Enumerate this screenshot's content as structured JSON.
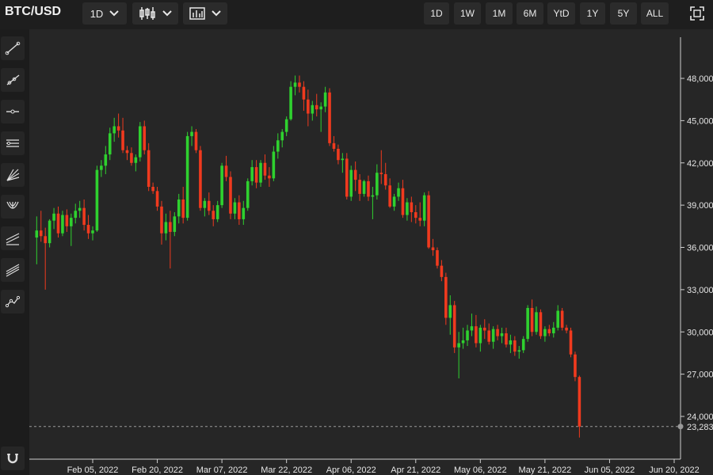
{
  "header": {
    "symbol": "BTC/USD",
    "interval_label": "1D",
    "chart_type_icon": "candlestick-icon",
    "indicators_icon": "indicators-icon",
    "ranges": [
      "1D",
      "1W",
      "1M",
      "6M",
      "YtD",
      "1Y",
      "5Y",
      "ALL"
    ],
    "fullscreen_icon": "fullscreen-icon"
  },
  "toolbar": {
    "tools": [
      "trend-line-icon",
      "ray-icon",
      "horizontal-line-icon",
      "parallel-channel-icon",
      "fib-fan-icon",
      "pitchfork-icon",
      "regression-channel-icon",
      "gann-fan-icon",
      "path-icon"
    ],
    "magnet_icon": "magnet-icon"
  },
  "colors": {
    "up": "#2fd12f",
    "down": "#f03a1e",
    "background": "#262626",
    "grid": "#3a3a3a"
  },
  "chart_data": {
    "type": "candlestick",
    "ylim": [
      21000,
      50500
    ],
    "y_ticks": [
      "48,000",
      "45,000",
      "42,000",
      "39,000",
      "36,000",
      "33,000",
      "30,000",
      "27,000",
      "24,000"
    ],
    "y_tick_values": [
      48000,
      45000,
      42000,
      39000,
      36000,
      33000,
      30000,
      27000,
      24000
    ],
    "x_ticks": [
      "Feb 05, 2022",
      "Feb 20, 2022",
      "Mar 07, 2022",
      "Mar 22, 2022",
      "Apr 06, 2022",
      "Apr 21, 2022",
      "May 06, 2022",
      "May 21, 2022",
      "Jun 05, 2022",
      "Jun 20, 2022"
    ],
    "x_tick_days": [
      35,
      50,
      65,
      80,
      95,
      110,
      125,
      140,
      155,
      170
    ],
    "first_day": 22,
    "last_price": 23283,
    "last_price_label": "23,283",
    "candles": [
      [
        36700,
        38200,
        34800,
        37200
      ],
      [
        37200,
        38600,
        36400,
        36800
      ],
      [
        36800,
        37400,
        33000,
        36300
      ],
      [
        36300,
        38000,
        36000,
        37900
      ],
      [
        37900,
        38800,
        37300,
        38400
      ],
      [
        38400,
        38900,
        36700,
        37000
      ],
      [
        37000,
        38600,
        36800,
        38300
      ],
      [
        38300,
        38700,
        37100,
        37500
      ],
      [
        37500,
        38400,
        36100,
        38100
      ],
      [
        38100,
        39100,
        37700,
        38600
      ],
      [
        38600,
        39300,
        38100,
        38800
      ],
      [
        38800,
        39400,
        37200,
        37600
      ],
      [
        37600,
        38300,
        36600,
        37000
      ],
      [
        37000,
        37500,
        36500,
        37200
      ],
      [
        37200,
        41800,
        37100,
        41500
      ],
      [
        41500,
        42200,
        41000,
        41800
      ],
      [
        41800,
        43200,
        41200,
        42600
      ],
      [
        42600,
        44500,
        42200,
        44100
      ],
      [
        44100,
        45200,
        43500,
        44600
      ],
      [
        44600,
        45500,
        43800,
        44300
      ],
      [
        44300,
        45200,
        42700,
        42900
      ],
      [
        42900,
        43200,
        42200,
        42700
      ],
      [
        42700,
        43100,
        41800,
        42000
      ],
      [
        42000,
        42600,
        41400,
        42400
      ],
      [
        42400,
        44900,
        42100,
        44600
      ],
      [
        44600,
        45000,
        42600,
        42900
      ],
      [
        42900,
        43400,
        40000,
        40300
      ],
      [
        40300,
        40600,
        39800,
        40000
      ],
      [
        40000,
        40300,
        38600,
        38900
      ],
      [
        38900,
        39300,
        36200,
        37000
      ],
      [
        37000,
        38400,
        36500,
        37800
      ],
      [
        37800,
        38600,
        34500,
        37100
      ],
      [
        37100,
        38500,
        36800,
        38200
      ],
      [
        38200,
        39800,
        37700,
        39400
      ],
      [
        39400,
        40300,
        37700,
        38100
      ],
      [
        38100,
        44200,
        37900,
        43900
      ],
      [
        43900,
        44600,
        43200,
        44200
      ],
      [
        44200,
        44400,
        42700,
        42900
      ],
      [
        42900,
        43200,
        38600,
        38800
      ],
      [
        38800,
        39500,
        38200,
        39300
      ],
      [
        39300,
        39900,
        38300,
        38600
      ],
      [
        38600,
        39000,
        37500,
        38000
      ],
      [
        38000,
        39300,
        37800,
        39000
      ],
      [
        39000,
        42000,
        38800,
        41800
      ],
      [
        41800,
        42500,
        40700,
        41000
      ],
      [
        41000,
        41400,
        38000,
        38400
      ],
      [
        38400,
        39500,
        38000,
        39200
      ],
      [
        39200,
        39700,
        37600,
        38000
      ],
      [
        38000,
        39300,
        37600,
        38800
      ],
      [
        38800,
        40900,
        38600,
        40700
      ],
      [
        40700,
        42200,
        40400,
        41700
      ],
      [
        41700,
        42200,
        40200,
        40600
      ],
      [
        40600,
        42200,
        40300,
        42000
      ],
      [
        42000,
        42600,
        40800,
        41100
      ],
      [
        41100,
        41700,
        40300,
        40900
      ],
      [
        40900,
        43200,
        40700,
        42800
      ],
      [
        42800,
        44100,
        42300,
        43600
      ],
      [
        43600,
        44400,
        43100,
        44200
      ],
      [
        44200,
        45300,
        43900,
        45100
      ],
      [
        45100,
        47800,
        45000,
        47400
      ],
      [
        47400,
        48200,
        46800,
        47700
      ],
      [
        47700,
        48200,
        47000,
        47400
      ],
      [
        47400,
        47800,
        45700,
        46500
      ],
      [
        46500,
        47200,
        44600,
        45500
      ],
      [
        45500,
        46400,
        45000,
        46100
      ],
      [
        46100,
        46900,
        45300,
        45800
      ],
      [
        45800,
        46300,
        44200,
        46000
      ],
      [
        46000,
        47400,
        45600,
        47000
      ],
      [
        47000,
        47300,
        43200,
        43400
      ],
      [
        43400,
        43900,
        42800,
        43000
      ],
      [
        43000,
        43300,
        41900,
        42200
      ],
      [
        42200,
        42700,
        41300,
        42300
      ],
      [
        42300,
        42700,
        39400,
        39600
      ],
      [
        39600,
        41800,
        39300,
        41500
      ],
      [
        41500,
        42100,
        40000,
        40800
      ],
      [
        40800,
        41200,
        39300,
        39800
      ],
      [
        39800,
        40800,
        39600,
        40700
      ],
      [
        40700,
        41100,
        39300,
        39600
      ],
      [
        39600,
        40300,
        38000,
        39700
      ],
      [
        39700,
        41900,
        39400,
        41300
      ],
      [
        41300,
        42900,
        40500,
        41200
      ],
      [
        41200,
        42000,
        40100,
        40400
      ],
      [
        40400,
        40900,
        38800,
        38900
      ],
      [
        38900,
        39800,
        38600,
        39600
      ],
      [
        39600,
        40600,
        39300,
        40200
      ],
      [
        40200,
        40800,
        38100,
        38300
      ],
      [
        38300,
        39500,
        37900,
        39200
      ],
      [
        39200,
        39600,
        37800,
        38500
      ],
      [
        38500,
        39000,
        37700,
        38100
      ],
      [
        38100,
        39200,
        37500,
        37900
      ],
      [
        37900,
        39900,
        37500,
        39700
      ],
      [
        39700,
        40000,
        35900,
        36000
      ],
      [
        36000,
        36600,
        35400,
        35800
      ],
      [
        35800,
        36000,
        34500,
        34700
      ],
      [
        34700,
        35100,
        33600,
        33900
      ],
      [
        33900,
        34200,
        30500,
        31000
      ],
      [
        31000,
        32600,
        29800,
        31900
      ],
      [
        31900,
        32200,
        28500,
        28900
      ],
      [
        28900,
        30000,
        26700,
        29200
      ],
      [
        29200,
        30300,
        28800,
        29400
      ],
      [
        29400,
        30500,
        29000,
        30100
      ],
      [
        30100,
        31300,
        29700,
        30400
      ],
      [
        30400,
        31200,
        28900,
        29200
      ],
      [
        29200,
        30500,
        28600,
        30300
      ],
      [
        30300,
        30900,
        29500,
        30100
      ],
      [
        30100,
        30600,
        29100,
        29300
      ],
      [
        29300,
        30400,
        28800,
        30200
      ],
      [
        30200,
        30500,
        29400,
        29700
      ],
      [
        29700,
        30300,
        29200,
        29900
      ],
      [
        29900,
        30300,
        28900,
        29100
      ],
      [
        29100,
        29800,
        28500,
        29400
      ],
      [
        29400,
        29700,
        28300,
        28600
      ],
      [
        28600,
        29000,
        28100,
        28700
      ],
      [
        28700,
        29700,
        28500,
        29500
      ],
      [
        29500,
        31900,
        29300,
        31700
      ],
      [
        31700,
        32300,
        29700,
        30000
      ],
      [
        30000,
        31800,
        29800,
        31400
      ],
      [
        31400,
        31600,
        29500,
        29700
      ],
      [
        29700,
        30400,
        29300,
        30200
      ],
      [
        30200,
        30500,
        29700,
        29900
      ],
      [
        29900,
        30700,
        29600,
        30300
      ],
      [
        30300,
        31900,
        30100,
        31500
      ],
      [
        31500,
        31700,
        30100,
        30300
      ],
      [
        30300,
        30500,
        29900,
        30100
      ],
      [
        30100,
        30300,
        28200,
        28400
      ],
      [
        28400,
        28600,
        26500,
        26800
      ],
      [
        26800,
        26900,
        22500,
        23283
      ]
    ]
  }
}
